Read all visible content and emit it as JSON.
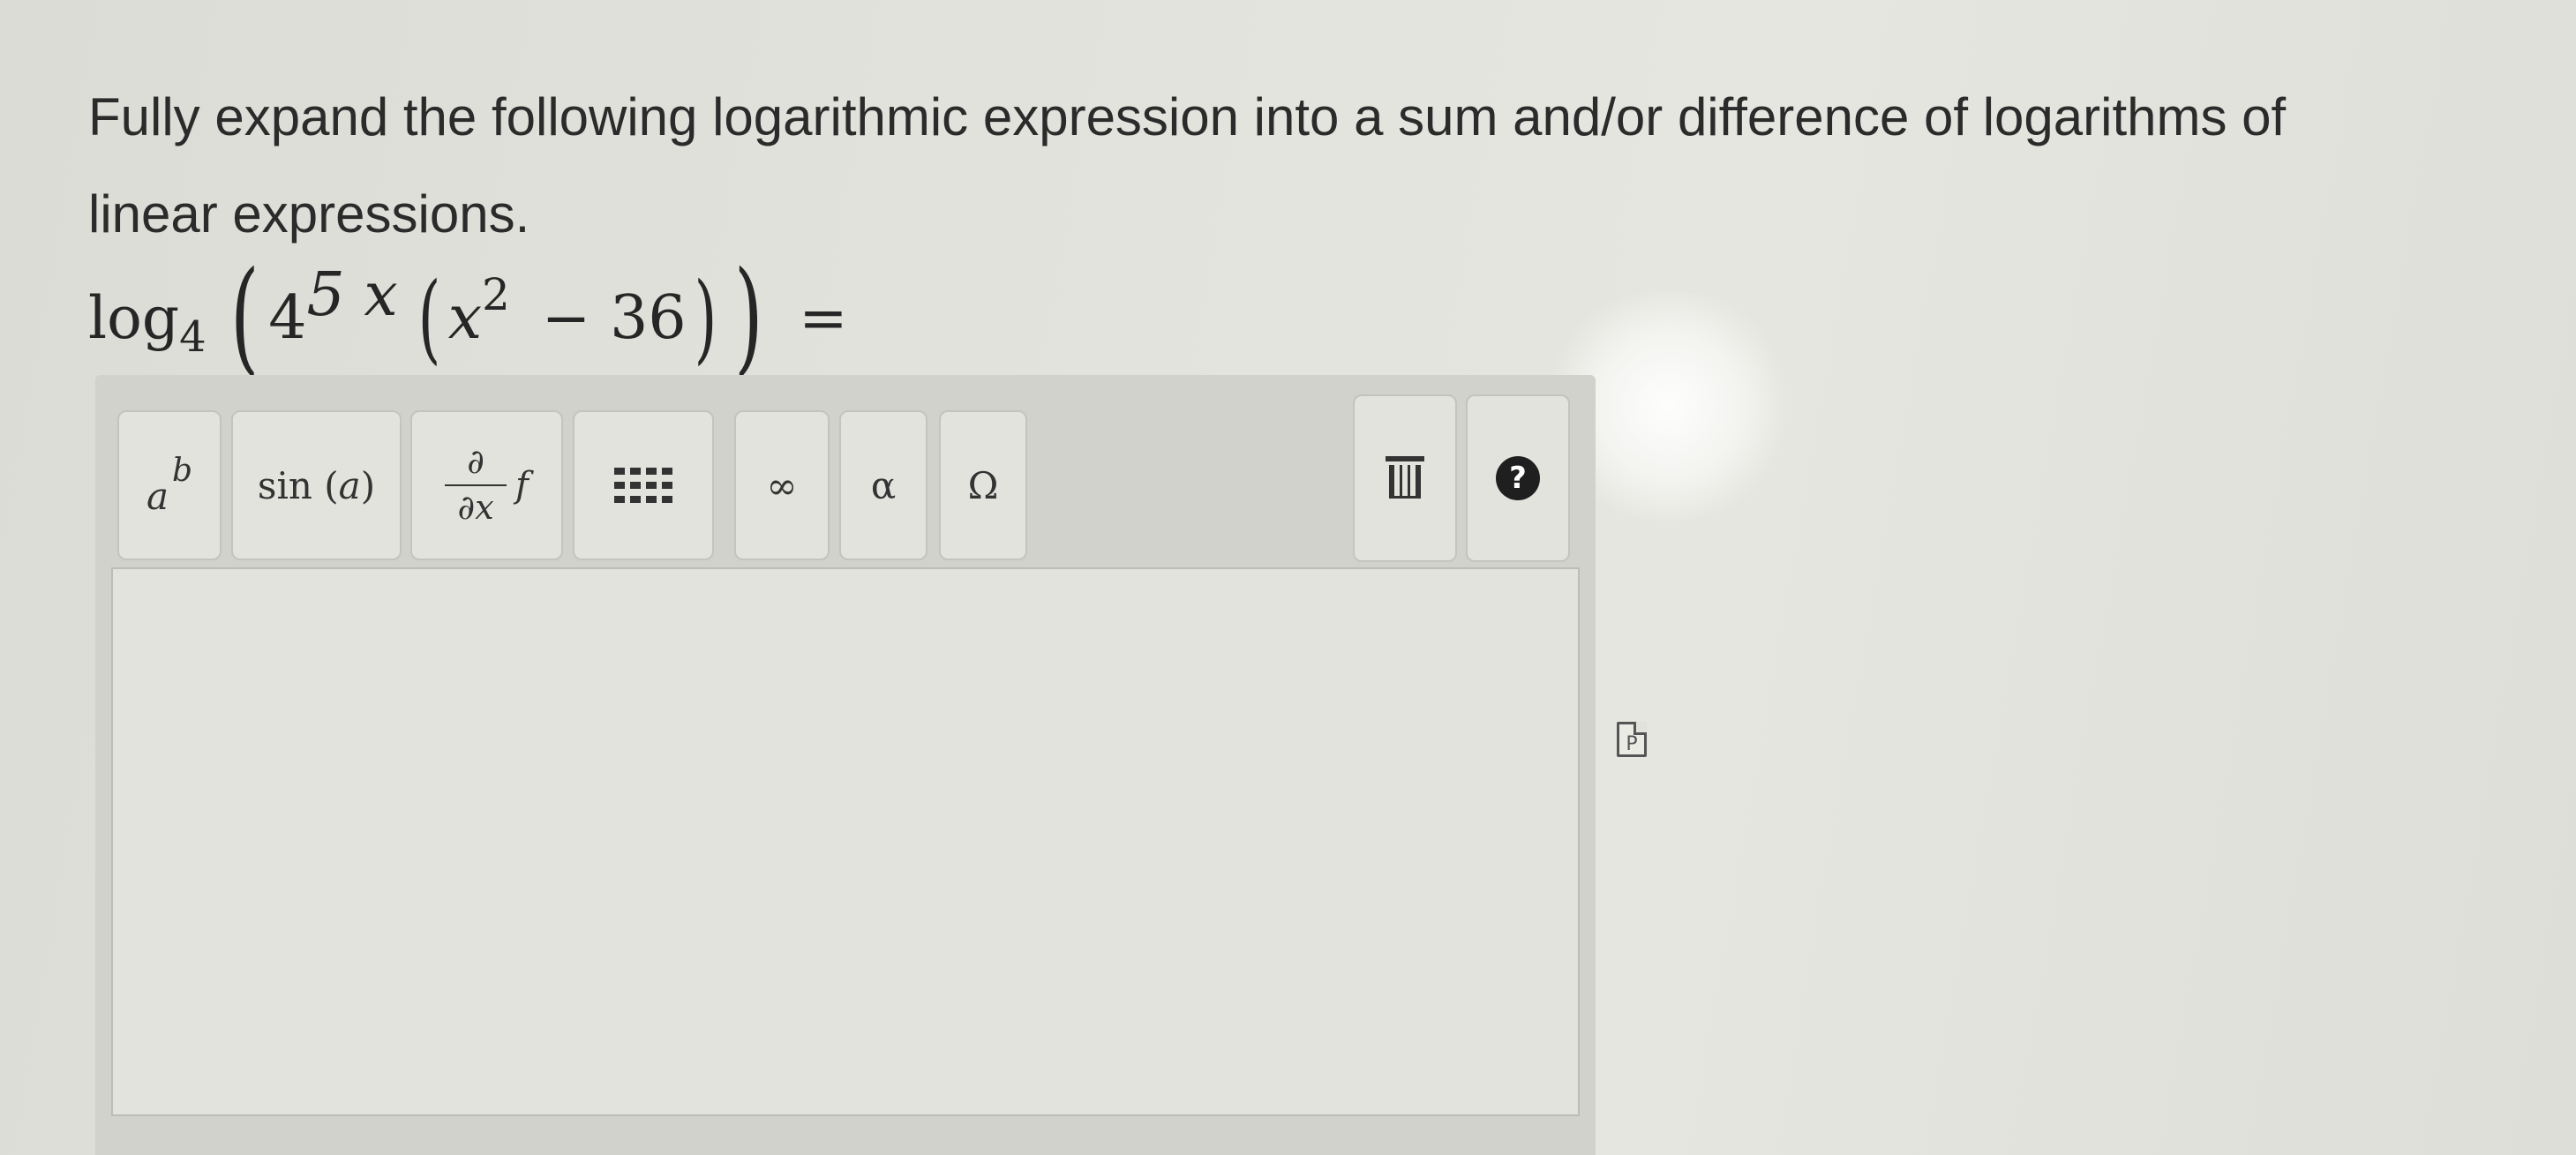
{
  "question": {
    "line1": "Fully expand the following logarithmic expression into a sum and/or difference of logarithms of",
    "line2": "linear expressions."
  },
  "expression": {
    "log": "log",
    "base": "4",
    "open_outer": "(",
    "coef_base": "4",
    "coef_exp": "5 x",
    "open_inner": "(",
    "var": "x",
    "var_exp": "2",
    "minus": "−",
    "constant": "36",
    "close_inner": ")",
    "close_outer": ")",
    "equals": "="
  },
  "toolbar": {
    "power": {
      "base": "a",
      "exp": "b",
      "icon": "power-icon"
    },
    "trig": {
      "prefix": "sin (",
      "arg": "a",
      "suffix": ")"
    },
    "derivative": {
      "numerator": "∂",
      "denominator": "∂x",
      "func": "f"
    },
    "matrix": {
      "icon": "matrix-icon"
    },
    "infinity": "∞",
    "alpha": "α",
    "omega": "Ω",
    "trash": {
      "icon": "trash-icon"
    },
    "help": {
      "icon": "help-icon",
      "label": "?"
    }
  },
  "answer": {
    "value": ""
  },
  "side_icon": {
    "icon": "document-icon",
    "label": "P"
  }
}
